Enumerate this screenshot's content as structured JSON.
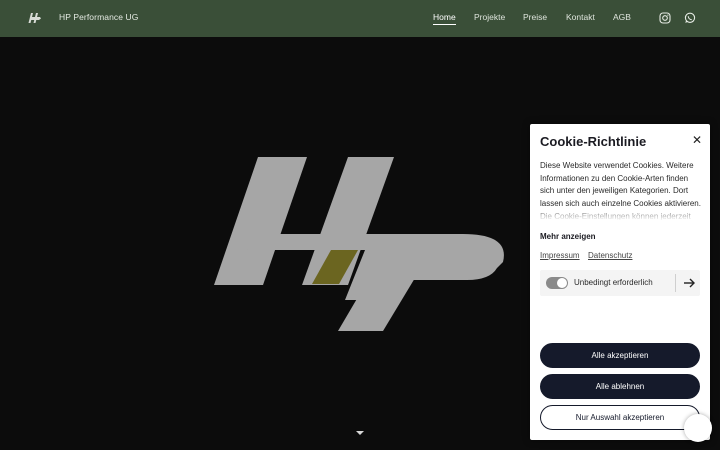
{
  "header": {
    "brand_name": "HP Performance UG",
    "nav": [
      {
        "label": "Home",
        "active": true
      },
      {
        "label": "Projekte",
        "active": false
      },
      {
        "label": "Preise",
        "active": false
      },
      {
        "label": "Kontakt",
        "active": false
      },
      {
        "label": "AGB",
        "active": false
      }
    ],
    "social_icons": [
      "instagram-icon",
      "whatsapp-icon"
    ],
    "background_color": "#3a4f38"
  },
  "hero": {
    "background_color": "#0c0c0c",
    "logo_color": "#a6a6a6",
    "logo_accent_color": "#6b6520"
  },
  "cookie": {
    "title": "Cookie-Richtlinie",
    "close_icon": "close-icon",
    "description": "Diese Website verwendet Cookies. Weitere Informationen zu den Cookie-Arten finden sich unter den jeweiligen Kategorien. Dort lassen sich auch einzelne Cookies aktivieren. Die Cookie-Einstellungen können jederzeit",
    "show_more": "Mehr anzeigen",
    "links": [
      "Impressum",
      "Datenschutz"
    ],
    "category": {
      "label": "Unbedingt erforderlich",
      "enabled": true
    },
    "buttons": {
      "accept_all": "Alle akzeptieren",
      "reject_all": "Alle ablehnen",
      "accept_selection": "Nur Auswahl akzeptieren"
    },
    "button_color": "#151a2b"
  }
}
